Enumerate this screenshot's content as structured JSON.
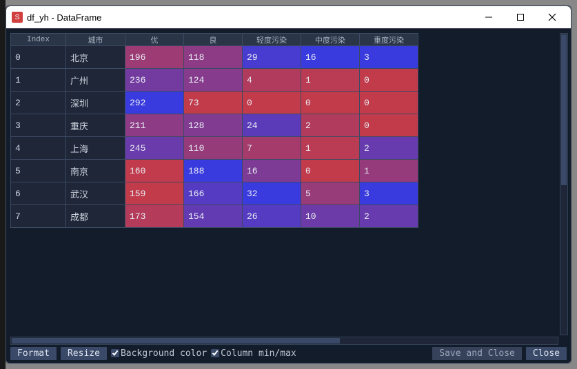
{
  "window": {
    "title": "df_yh - DataFrame",
    "app_icon_text": "S"
  },
  "columns": {
    "index": "Index",
    "city": "城市",
    "c1": "优",
    "c2": "良",
    "c3": "轻度污染",
    "c4": "中度污染",
    "c5": "重度污染"
  },
  "rows": [
    {
      "idx": "0",
      "city": "北京",
      "v": [
        196,
        118,
        29,
        16,
        3
      ]
    },
    {
      "idx": "1",
      "city": "广州",
      "v": [
        236,
        124,
        4,
        1,
        0
      ]
    },
    {
      "idx": "2",
      "city": "深圳",
      "v": [
        292,
        73,
        0,
        0,
        0
      ]
    },
    {
      "idx": "3",
      "city": "重庆",
      "v": [
        211,
        128,
        24,
        2,
        0
      ]
    },
    {
      "idx": "4",
      "city": "上海",
      "v": [
        245,
        110,
        7,
        1,
        2
      ]
    },
    {
      "idx": "5",
      "city": "南京",
      "v": [
        160,
        188,
        16,
        0,
        1
      ]
    },
    {
      "idx": "6",
      "city": "武汉",
      "v": [
        159,
        166,
        32,
        5,
        3
      ]
    },
    {
      "idx": "7",
      "city": "成都",
      "v": [
        173,
        154,
        26,
        10,
        2
      ]
    }
  ],
  "col_ranges": {
    "0": {
      "min": 159,
      "max": 292
    },
    "1": {
      "min": 73,
      "max": 188
    },
    "2": {
      "min": 0,
      "max": 32
    },
    "3": {
      "min": 0,
      "max": 16
    },
    "4": {
      "min": 0,
      "max": 3
    }
  },
  "heat": {
    "low": "#c23b4b",
    "high": "#3a3bde"
  },
  "footer": {
    "format": "Format",
    "resize": "Resize",
    "bgcolor": "Background color",
    "minmax": "Column min/max",
    "save": "Save and Close",
    "close": "Close"
  },
  "chart_data": {
    "type": "table",
    "title": "df_yh - DataFrame",
    "columns": [
      "城市",
      "优",
      "良",
      "轻度污染",
      "中度污染",
      "重度污染"
    ],
    "index": [
      0,
      1,
      2,
      3,
      4,
      5,
      6,
      7
    ],
    "data": [
      [
        "北京",
        196,
        118,
        29,
        16,
        3
      ],
      [
        "广州",
        236,
        124,
        4,
        1,
        0
      ],
      [
        "深圳",
        292,
        73,
        0,
        0,
        0
      ],
      [
        "重庆",
        211,
        128,
        24,
        2,
        0
      ],
      [
        "上海",
        245,
        110,
        7,
        1,
        2
      ],
      [
        "南京",
        160,
        188,
        16,
        0,
        1
      ],
      [
        "武汉",
        159,
        166,
        32,
        5,
        3
      ],
      [
        "成都",
        173,
        154,
        26,
        10,
        2
      ]
    ]
  }
}
